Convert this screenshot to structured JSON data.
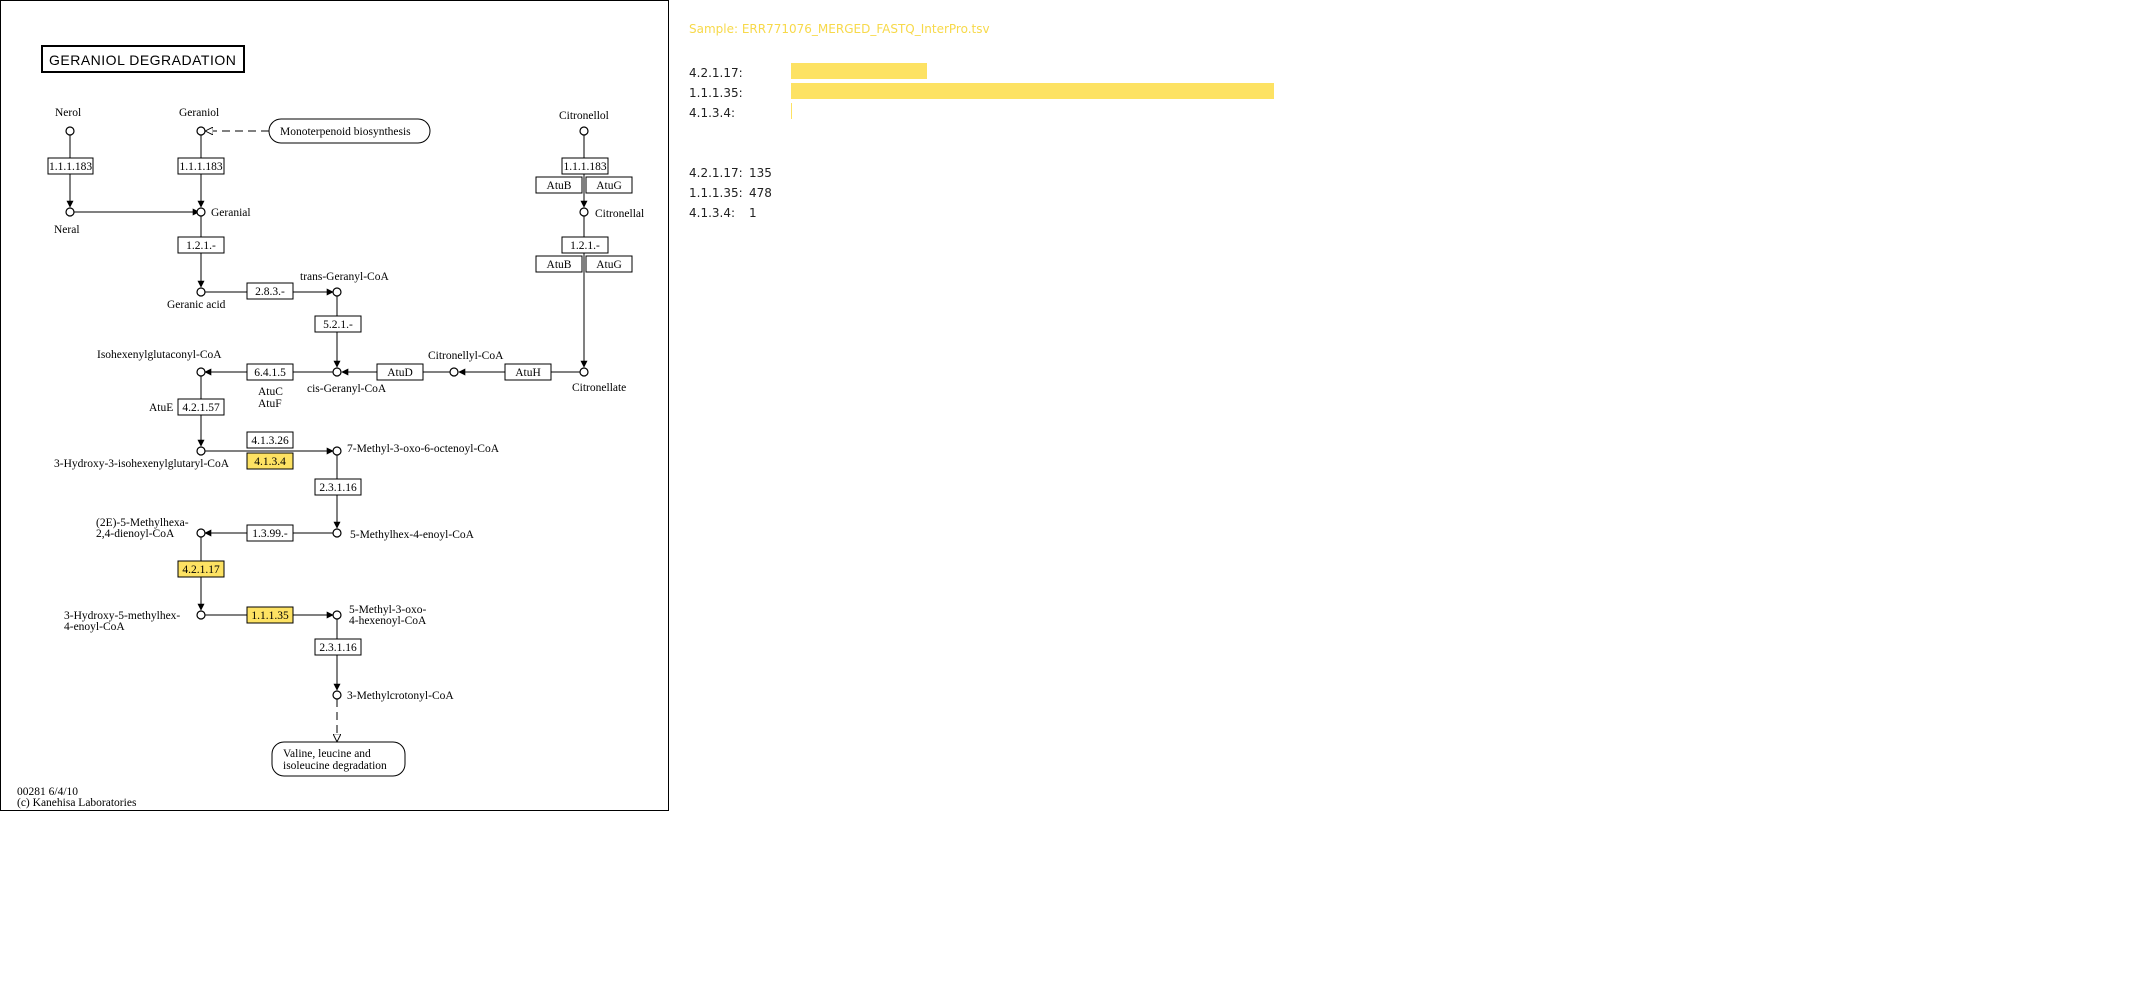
{
  "map": {
    "title": "GERANIOL  DEGRADATION",
    "footer_id": "00281 6/4/10",
    "footer_copyright": "(c) Kanehisa Laboratories",
    "highlight_color": "#fde263",
    "compounds": {
      "nerol": "Nerol",
      "geraniol": "Geraniol",
      "citronellol": "Citronellol",
      "neral": "Neral",
      "geranial": "Geranial",
      "citronellal": "Citronellal",
      "geranic_acid": "Geranic acid",
      "trans_geranyl_coa": "trans-Geranyl-CoA",
      "isohexenylglutaconyl_coa": "Isohexenylglutaconyl-CoA",
      "cis_geranyl_coa": "cis-Geranyl-CoA",
      "citronellyl_coa": "Citronellyl-CoA",
      "citronellate": "Citronellate",
      "hydroxy_isohexenylglutaryl_coa": "3-Hydroxy-3-isohexenylglutaryl-CoA",
      "methyl_oxo_octenoyl_coa": "7-Methyl-3-oxo-6-octenoyl-CoA",
      "methylhexa_dienoyl_coa_1": "(2E)-5-Methylhexa-",
      "methylhexa_dienoyl_coa_2": "2,4-dienoyl-CoA",
      "methylhex_enoyl_coa": "5-Methylhex-4-enoyl-CoA",
      "hydroxy_methylhex_1": "3-Hydroxy-5-methylhex-",
      "hydroxy_methylhex_2": "4-enoyl-CoA",
      "methyl_oxo_hexenoyl_1": "5-Methyl-3-oxo-",
      "methyl_oxo_hexenoyl_2": "4-hexenoyl-CoA",
      "methylcrotonyl_coa": "3-Methylcrotonyl-CoA"
    },
    "pathways": {
      "monoterpenoid": "Monoterpenoid biosynthesis",
      "valine_1": "Valine, leucine and",
      "valine_2": "isoleucine degradation"
    },
    "enzymes": {
      "e_nerol": "1.1.1.183",
      "e_geraniol": "1.1.1.183",
      "e_citronellol": "1.1.1.183",
      "atub_1": "AtuB",
      "atug_1": "AtuG",
      "e_geranial": "1.2.1.-",
      "e_citronellal": "1.2.1.-",
      "atub_2": "AtuB",
      "atug_2": "AtuG",
      "e_283": "2.8.3.-",
      "e_521": "5.2.1.-",
      "e_6415": "6.4.1.5",
      "atud": "AtuD",
      "atuh": "AtuH",
      "atuc": "AtuC",
      "atuf": "AtuF",
      "atue": "AtuE",
      "e_42157": "4.2.1.57",
      "e_41326": "4.1.3.26",
      "e_4134": "4.1.3.4",
      "e_23116_a": "2.3.1.16",
      "e_1399": "1.3.99.-",
      "e_42117": "4.2.1.17",
      "e_11135": "1.1.1.35",
      "e_23116_b": "2.3.1.16"
    }
  },
  "sample": {
    "title": "Sample: ERR771076_MERGED_FASTQ_InterPro.tsv",
    "bar_color": "#fde263",
    "max_count": 478,
    "rows": [
      {
        "label": "4.2.1.17:",
        "count": 135
      },
      {
        "label": "1.1.1.35:",
        "count": 478
      },
      {
        "label": "4.1.3.4:",
        "count": 1
      }
    ],
    "counts": [
      {
        "label": "4.2.1.17:",
        "value": "135"
      },
      {
        "label": "1.1.1.35:",
        "value": "478"
      },
      {
        "label": "4.1.3.4:",
        "value": "1"
      }
    ]
  }
}
